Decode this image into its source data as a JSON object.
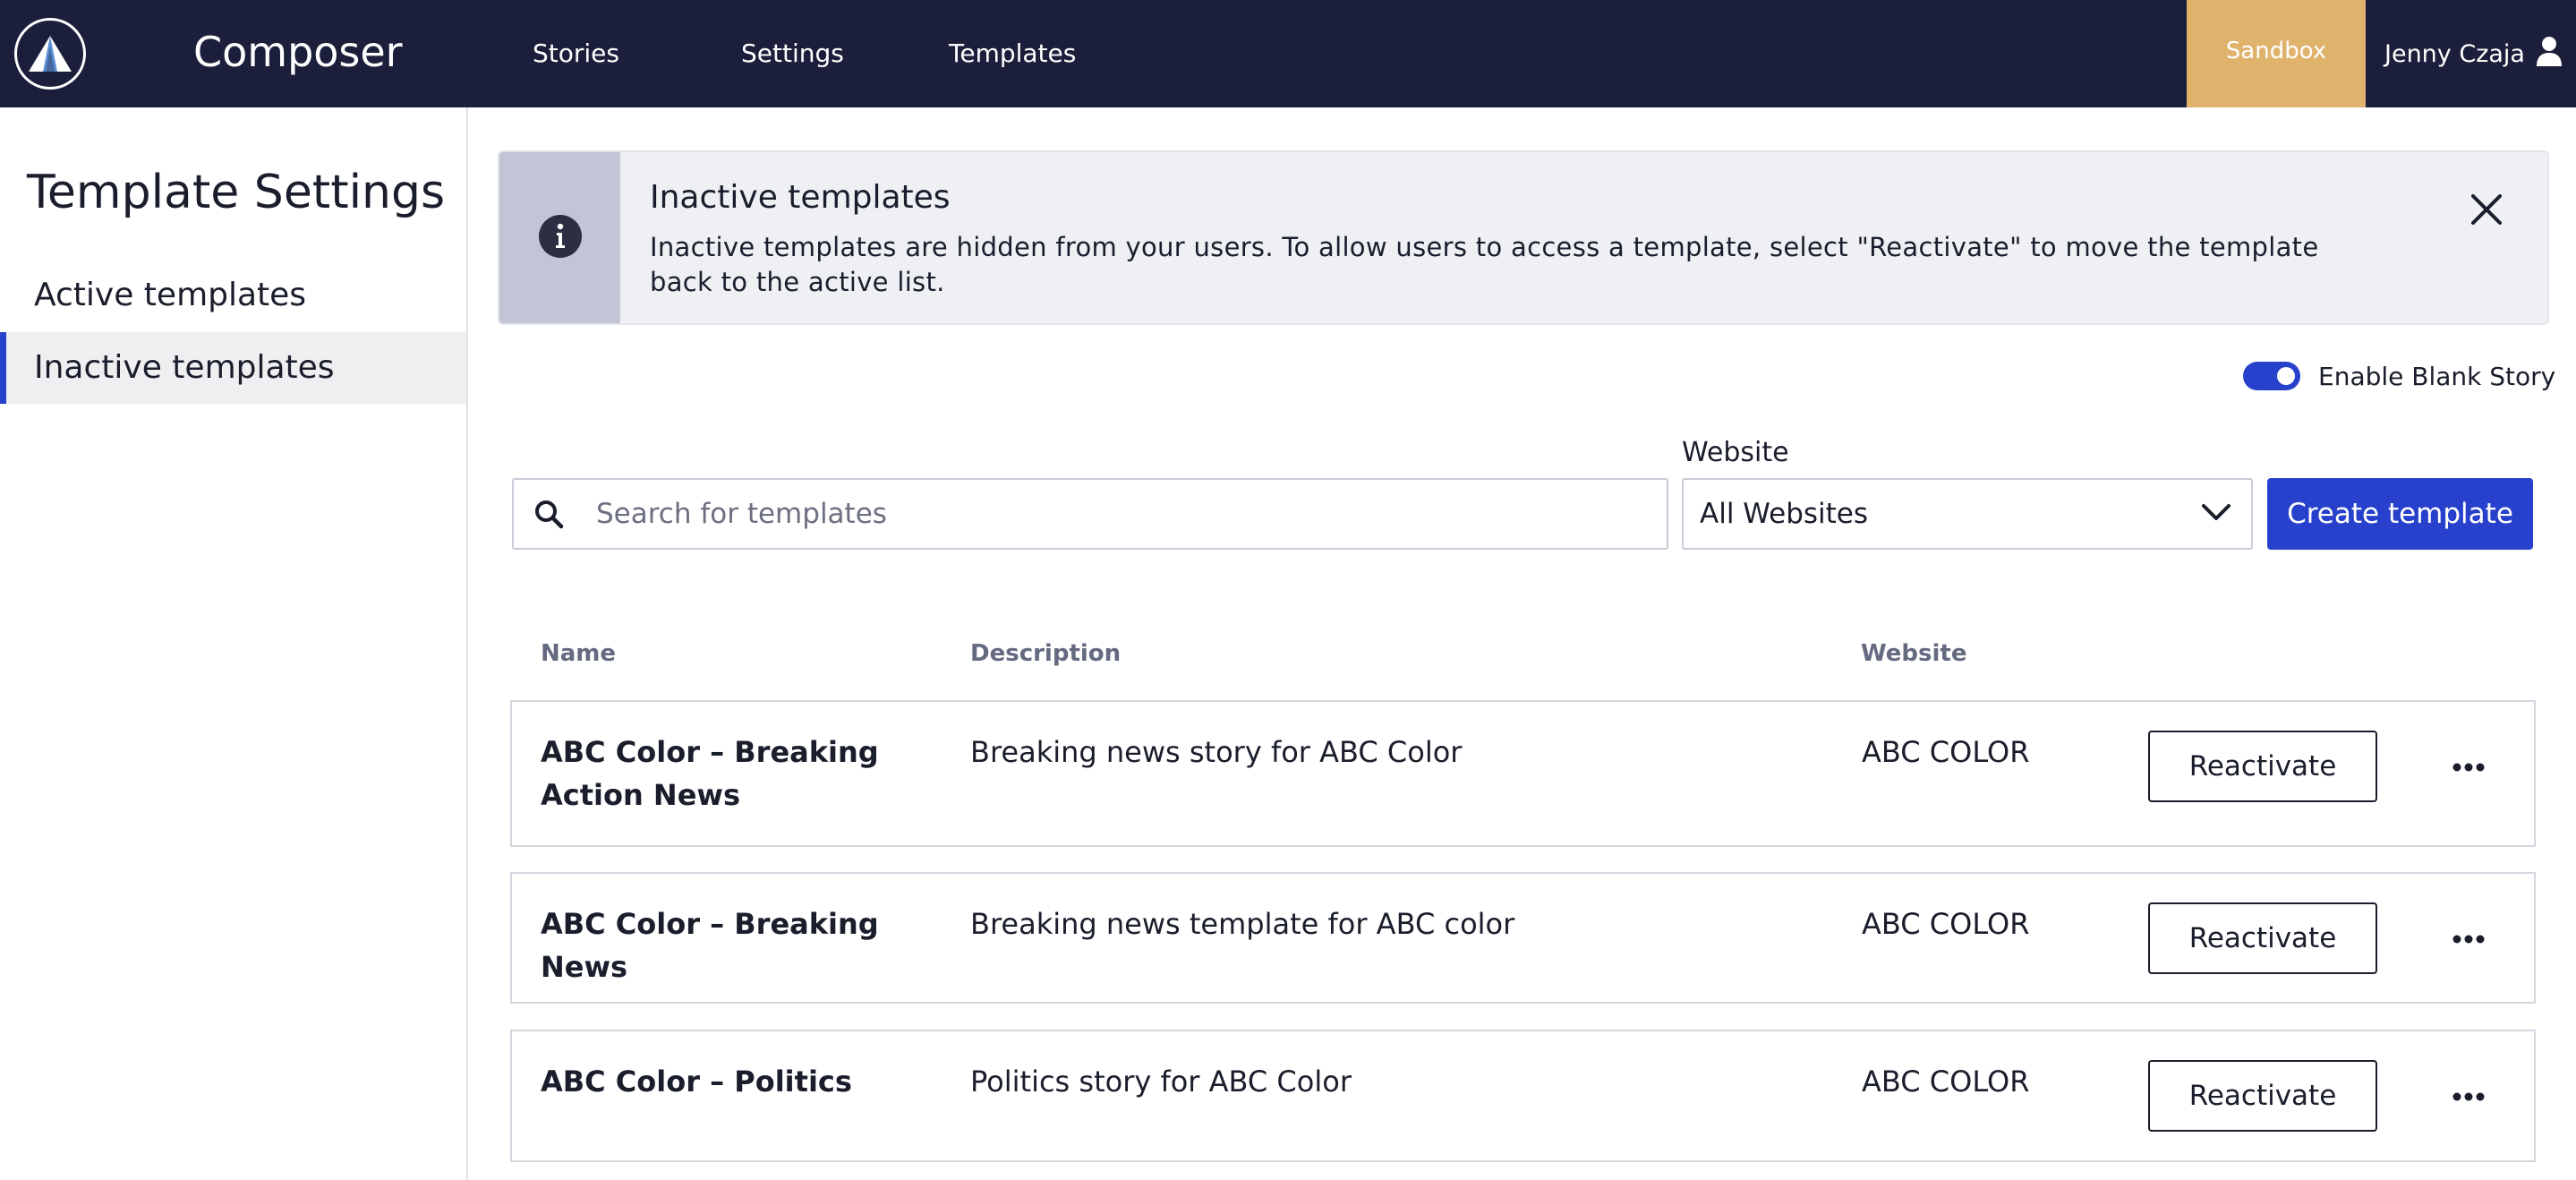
{
  "header": {
    "app_title": "Composer",
    "nav": [
      {
        "label": "Stories"
      },
      {
        "label": "Settings"
      },
      {
        "label": "Templates"
      }
    ],
    "environment_badge": "Sandbox",
    "user_name": "Jenny Czaja",
    "colors": {
      "background": "#1c1f3b",
      "sandbox": "#e0b36d"
    }
  },
  "sidebar": {
    "title": "Template Settings",
    "items": [
      {
        "label": "Active templates",
        "selected": false
      },
      {
        "label": "Inactive templates",
        "selected": true
      }
    ]
  },
  "banner": {
    "icon": "info-icon",
    "title": "Inactive templates",
    "message": "Inactive templates are hidden from your users. To allow users to access a template, select \"Reactivate\" to move the template back to the active list.",
    "close_icon": "close-icon"
  },
  "toggle": {
    "label": "Enable Blank Story",
    "enabled": true
  },
  "filters": {
    "search_placeholder": "Search for templates",
    "search_value": "",
    "website_label": "Website",
    "website_selected": "All Websites",
    "create_label": "Create template"
  },
  "table": {
    "columns": [
      "Name",
      "Description",
      "Website"
    ],
    "rows": [
      {
        "name": "ABC Color – Breaking Action News",
        "description": "Breaking news story for ABC Color",
        "website": "ABC COLOR",
        "action": "Reactivate"
      },
      {
        "name": "ABC Color – Breaking News",
        "description": "Breaking news template for ABC color",
        "website": "ABC COLOR",
        "action": "Reactivate"
      },
      {
        "name": "ABC Color – Politics",
        "description": "Politics story for ABC Color",
        "website": "ABC COLOR",
        "action": "Reactivate"
      }
    ]
  },
  "accent_color": "#2741cc"
}
